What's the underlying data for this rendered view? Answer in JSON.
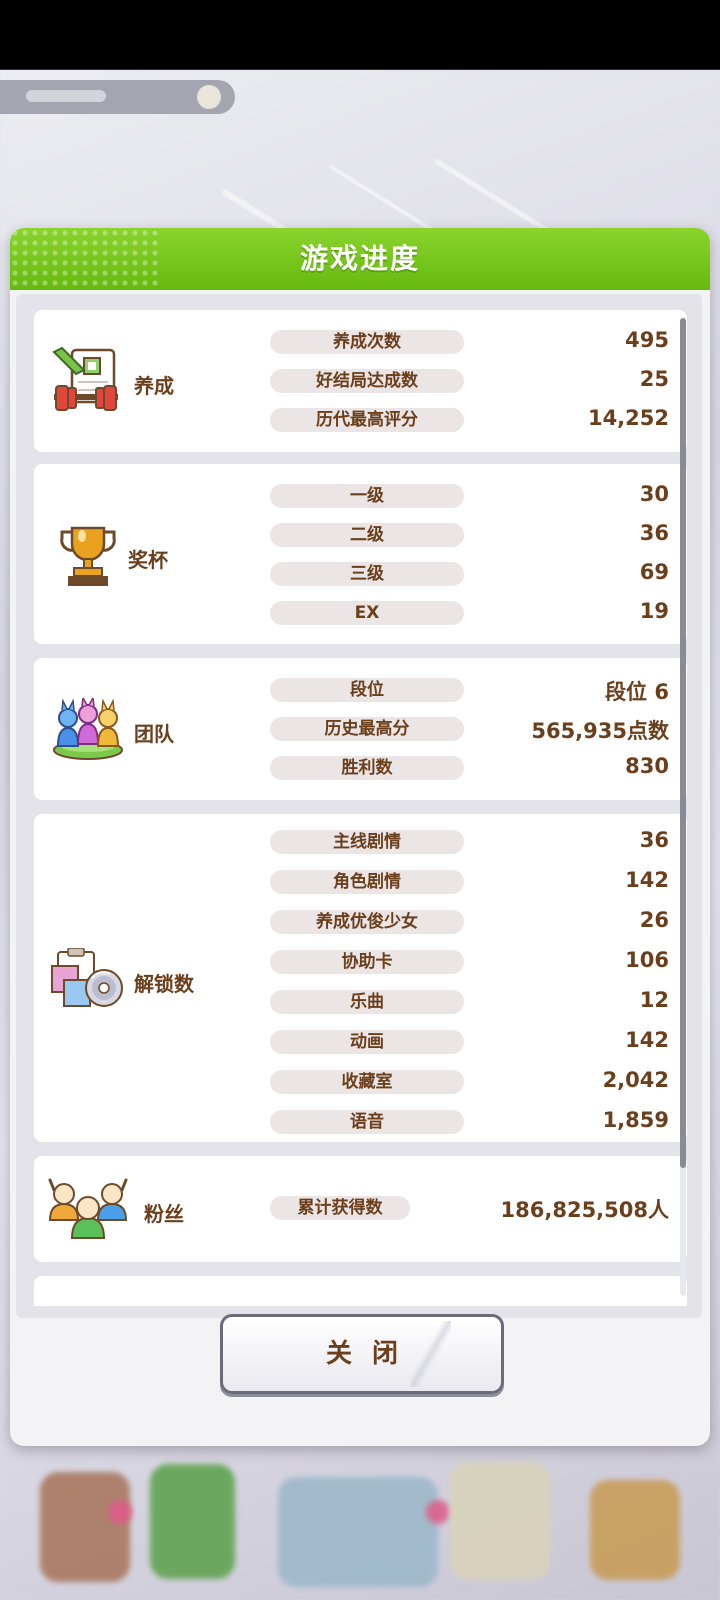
{
  "dialog": {
    "title": "游戏进度",
    "close_label": "关闭"
  },
  "sections": [
    {
      "id": "training",
      "label": "养成",
      "icon": "training-notebook-dumbbell-icon",
      "rows": [
        {
          "label": "养成次数",
          "value": "495"
        },
        {
          "label": "好结局达成数",
          "value": "25"
        },
        {
          "label": "历代最高评分",
          "value": "14,252"
        }
      ]
    },
    {
      "id": "trophy",
      "label": "奖杯",
      "icon": "trophy-icon",
      "rows": [
        {
          "label": "一级",
          "value": "30"
        },
        {
          "label": "二级",
          "value": "36"
        },
        {
          "label": "三级",
          "value": "69"
        },
        {
          "label": "EX",
          "value": "19"
        }
      ]
    },
    {
      "id": "team",
      "label": "团队",
      "icon": "team-figures-icon",
      "rows": [
        {
          "label": "段位",
          "value": "段位 6"
        },
        {
          "label": "历史最高分",
          "value": "565,935点数"
        },
        {
          "label": "胜利数",
          "value": "830"
        }
      ]
    },
    {
      "id": "unlock",
      "label": "解锁数",
      "icon": "unlock-cards-disc-icon",
      "rows": [
        {
          "label": "主线剧情",
          "value": "36"
        },
        {
          "label": "角色剧情",
          "value": "142"
        },
        {
          "label": "养成优俊少女",
          "value": "26"
        },
        {
          "label": "协助卡",
          "value": "106"
        },
        {
          "label": "乐曲",
          "value": "12"
        },
        {
          "label": "动画",
          "value": "142"
        },
        {
          "label": "收藏室",
          "value": "2,042"
        },
        {
          "label": "语音",
          "value": "1,859"
        }
      ]
    },
    {
      "id": "fans",
      "label": "粉丝",
      "icon": "fans-crowd-icon",
      "rows": [
        {
          "label": "累计获得数",
          "value": "186,825,508人"
        }
      ]
    }
  ],
  "colors": {
    "header_green": "#7cc81f",
    "text_brown": "#6b3f1c",
    "pill_bg": "#ece5e5",
    "card_bg": "#ffffff",
    "scroll_bg": "#e3e3e9"
  }
}
